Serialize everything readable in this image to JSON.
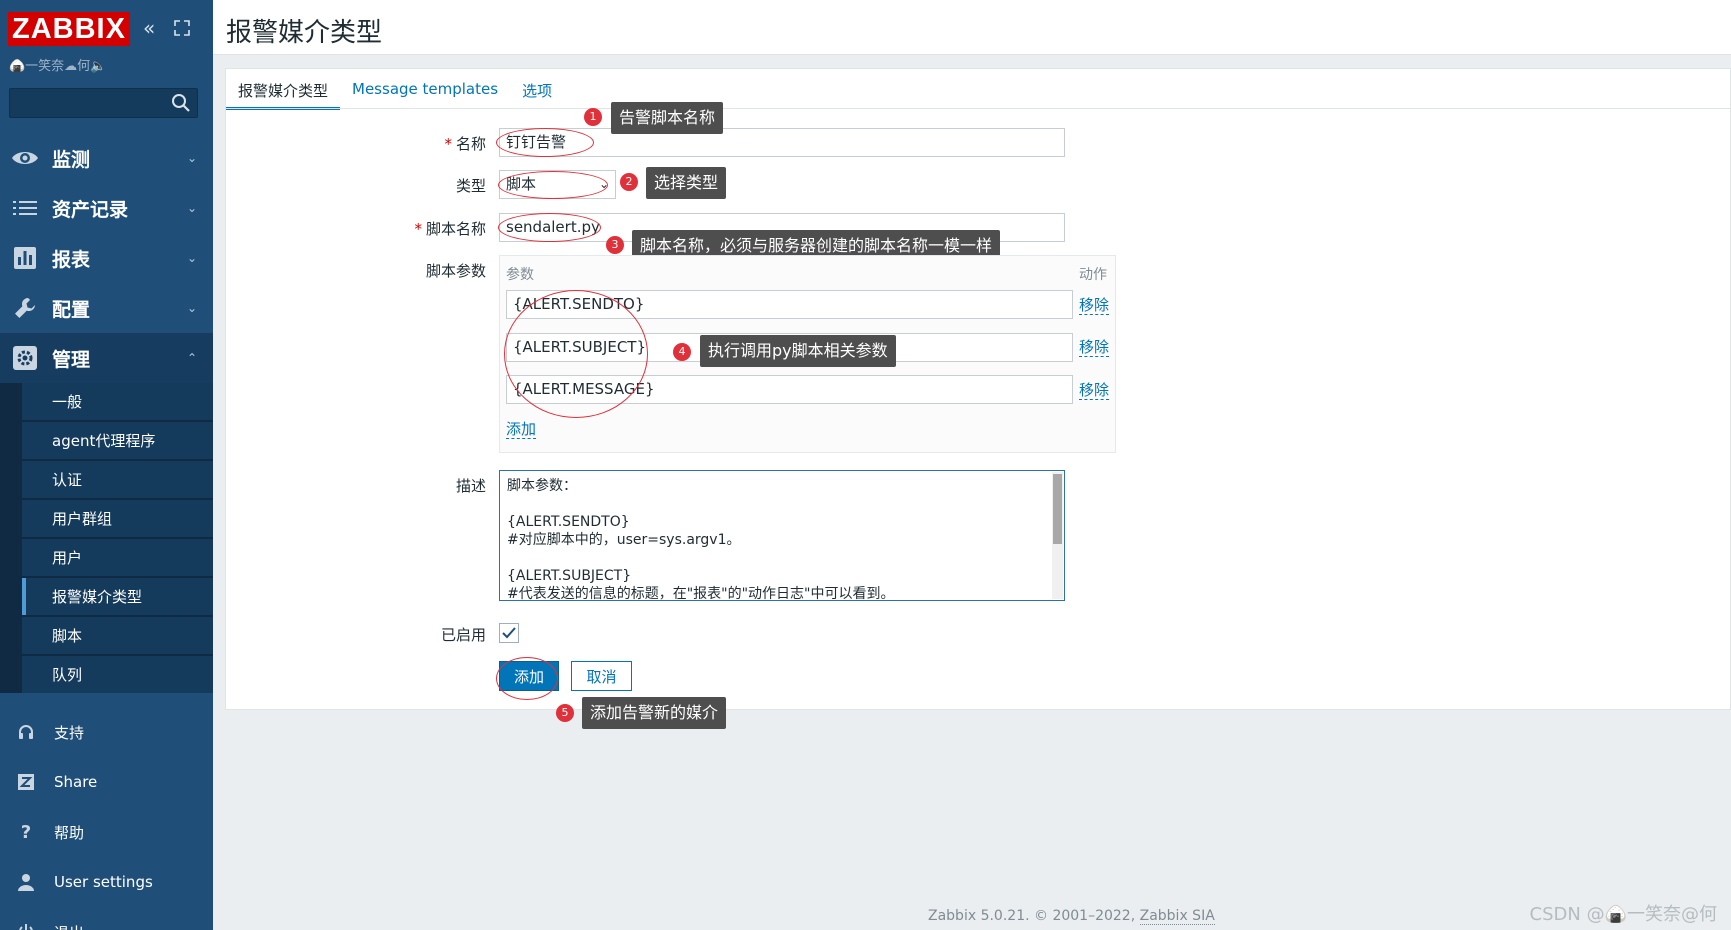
{
  "sidebar": {
    "logo": "ZABBIX",
    "user_label": "🍙一笑奈☁何🔈",
    "menu": [
      {
        "label": "监测",
        "icon": "eye-icon"
      },
      {
        "label": "资产记录",
        "icon": "list-icon"
      },
      {
        "label": "报表",
        "icon": "bar-chart-icon"
      },
      {
        "label": "配置",
        "icon": "wrench-icon"
      },
      {
        "label": "管理",
        "icon": "gear-icon"
      }
    ],
    "admin_items": [
      "一般",
      "agent代理程序",
      "认证",
      "用户群组",
      "用户",
      "报警媒介类型",
      "脚本",
      "队列"
    ],
    "bottom": [
      {
        "label": "支持",
        "icon": "headset-icon"
      },
      {
        "label": "Share",
        "icon": "zabbix-share-icon"
      },
      {
        "label": "帮助",
        "icon": "question-icon"
      },
      {
        "label": "User settings",
        "icon": "user-icon"
      },
      {
        "label": "退出",
        "icon": "power-icon"
      }
    ]
  },
  "header": {
    "title": "报警媒介类型"
  },
  "tabs": [
    "报警媒介类型",
    "Message templates",
    "选项"
  ],
  "form": {
    "name_label": "名称",
    "name_value": "钉钉告警",
    "type_label": "类型",
    "type_value": "脚本",
    "script_label": "脚本名称",
    "script_value": "sendalert.py",
    "params_label": "脚本参数",
    "params_header": "参数",
    "actions_header": "动作",
    "params": [
      "{ALERT.SENDTO}",
      "{ALERT.SUBJECT}",
      "{ALERT.MESSAGE}"
    ],
    "remove_label": "移除",
    "add_param_label": "添加",
    "desc_label": "描述",
    "desc_lines": [
      "脚本参数：",
      "",
      "{ALERT.SENDTO}",
      "#对应脚本中的，user=sys.argv1。",
      "",
      "{ALERT.SUBJECT}",
      "#代表发送的信息的标题，在\"报表\"的\"动作日志\"中可以看到。"
    ],
    "enabled_label": "已启用",
    "submit_label": "添加",
    "cancel_label": "取消"
  },
  "annotations": [
    {
      "num": "1",
      "text": "告警脚本名称"
    },
    {
      "num": "2",
      "text": "选择类型"
    },
    {
      "num": "3",
      "text": "脚本名称，必须与服务器创建的脚本名称一模一样"
    },
    {
      "num": "4",
      "text": "执行调用py脚本相关参数"
    },
    {
      "num": "5",
      "text": "添加告警新的媒介"
    }
  ],
  "footer": {
    "text": "Zabbix 5.0.21. © 2001–2022,",
    "link": "Zabbix SIA"
  },
  "watermark": "CSDN @🍙一笑奈@何",
  "colors": {
    "sidebar": "#1f4e79",
    "accent": "#0275b8",
    "logo": "#d40000",
    "annotation": "#e0303a"
  }
}
